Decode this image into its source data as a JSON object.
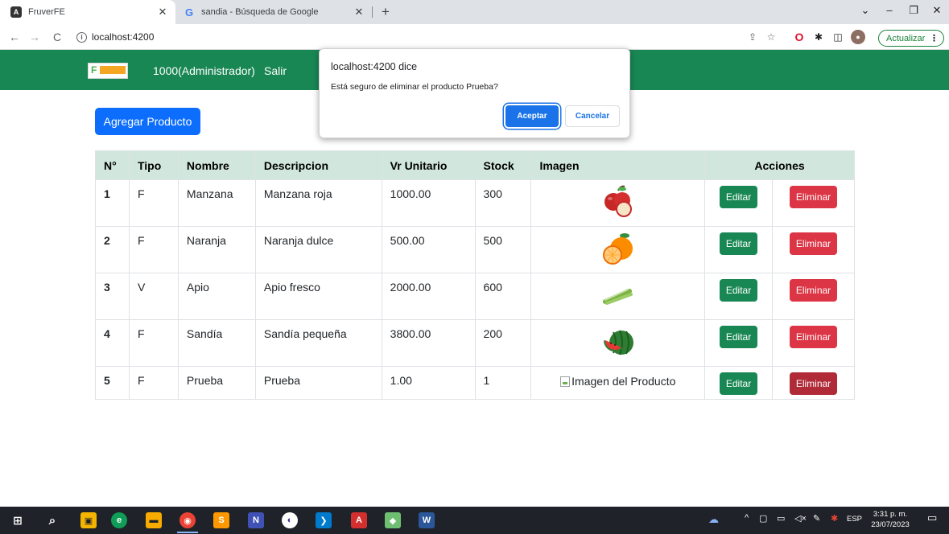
{
  "browser": {
    "tabs": [
      {
        "title": "FruverFE",
        "active": true
      },
      {
        "title": "sandia - Búsqueda de Google",
        "active": false
      }
    ],
    "url": "localhost:4200",
    "update_label": "Actualizar"
  },
  "app": {
    "user": "1000(Administrador)",
    "logout": "Salir",
    "add_label": "Agregar Producto",
    "table": {
      "headers": [
        "N°",
        "Tipo",
        "Nombre",
        "Descripcion",
        "Vr Unitario",
        "Stock",
        "Imagen",
        "Acciones"
      ],
      "rows": [
        {
          "n": "1",
          "tipo": "F",
          "nombre": "Manzana",
          "descripcion": "Manzana roja",
          "vr": "1000.00",
          "stock": "300",
          "image": "apple-image"
        },
        {
          "n": "2",
          "tipo": "F",
          "nombre": "Naranja",
          "descripcion": "Naranja dulce",
          "vr": "500.00",
          "stock": "500",
          "image": "orange-image"
        },
        {
          "n": "3",
          "tipo": "V",
          "nombre": "Apio",
          "descripcion": "Apio fresco",
          "vr": "2000.00",
          "stock": "600",
          "image": "celery-image"
        },
        {
          "n": "4",
          "tipo": "F",
          "nombre": "Sandía",
          "descripcion": "Sandía pequeña",
          "vr": "3800.00",
          "stock": "200",
          "image": "watermelon-image"
        },
        {
          "n": "5",
          "tipo": "F",
          "nombre": "Prueba",
          "descripcion": "Prueba",
          "vr": "1.00",
          "stock": "1",
          "image_alt": "Imagen del Producto"
        }
      ],
      "edit_label": "Editar",
      "delete_label": "Eliminar"
    }
  },
  "dialog": {
    "title": "localhost:4200 dice",
    "message": "Está seguro de eliminar el producto Prueba?",
    "ok_label": "Aceptar",
    "cancel_label": "Cancelar"
  },
  "taskbar": {
    "lang": "ESP",
    "time": "3:31 p. m.",
    "date": "23/07/2023"
  },
  "colors": {
    "navbar": "#198754",
    "primary": "#0d6efd",
    "danger": "#dc3545",
    "header_row": "#d1e7dd"
  }
}
